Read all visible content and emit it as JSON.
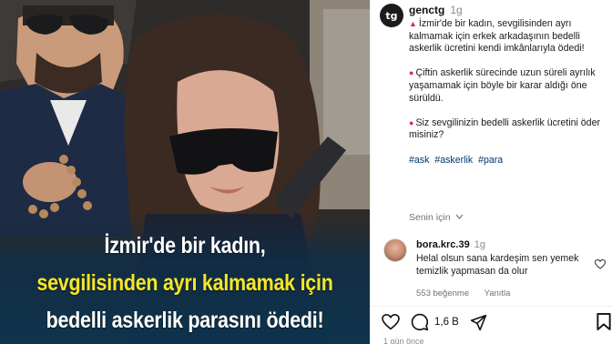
{
  "post": {
    "author": "genctg",
    "time": "1g",
    "avatar_text": "tg",
    "paragraphs": [
      "İzmir'de bir kadın, sevgilisinden ayrı kalmamak için erkek arkadaşının bedelli askerlik ücretini kendi imkânlarıyla ödedi!",
      "Çiftin askerlik sürecinde uzun süreli ayrılık yaşamamak için böyle bir karar aldığı öne sürüldü.",
      "Siz sevgilinizin bedelli askerlik ücretini öder misiniz?"
    ],
    "paragraph_icons": [
      "party-popper-icon",
      "pushpin-icon",
      "pushpin-icon"
    ],
    "hashtags": [
      "#ask",
      "#askerlik",
      "#para"
    ],
    "see_translation": "Senin için",
    "likes_count": "1,6 B",
    "posted_ago": "1 gün önce"
  },
  "comment": {
    "author": "bora.krc.39",
    "time": "1g",
    "text": "Helal olsun sana kardeşim sen yemek temizlik yapmasan da olur",
    "likes": "553 beğenme",
    "reply": "Yanıtla"
  },
  "image": {
    "headline_line1": "İzmir'de bir kadın,",
    "headline_line2": "sevgilisinden ayrı kalmamak için",
    "headline_line3": "bedelli askerlik parasını ödedi!"
  },
  "colors": {
    "headline_accent": "#f6e728",
    "overlay": "#0e344e",
    "hashtag": "#00376b"
  }
}
